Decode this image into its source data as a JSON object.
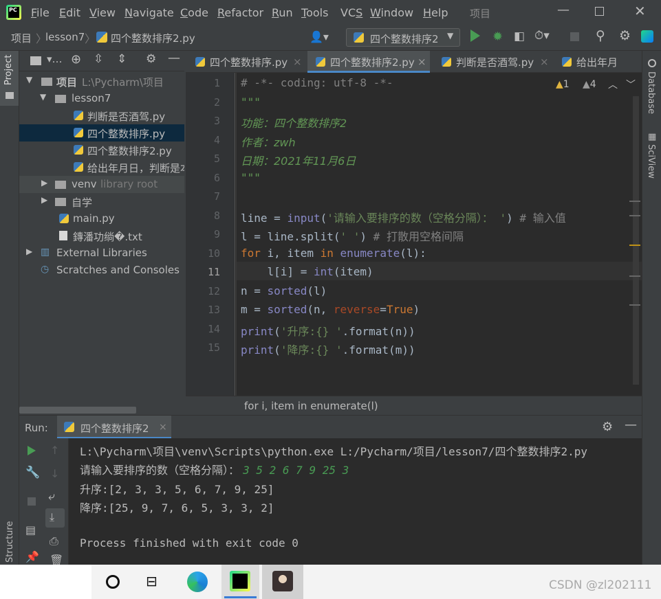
{
  "app": {
    "logo": "PC",
    "project_title": "项目"
  },
  "menu": [
    "File",
    "Edit",
    "View",
    "Navigate",
    "Code",
    "Refactor",
    "Run",
    "Tools",
    "VCS",
    "Window",
    "Help"
  ],
  "menu_mnemonic": [
    "F",
    "E",
    "V",
    "N",
    "C",
    "R",
    "R",
    "T",
    "S",
    "W",
    "H"
  ],
  "breadcrumb": {
    "root": "项目",
    "folder": "lesson7",
    "file": "四个整数排序2.py"
  },
  "run_config": "四个整数排序2",
  "left_tool": {
    "project": "Project",
    "structure": "Structure"
  },
  "right_tool": {
    "database": "Database",
    "sciview": "SciView"
  },
  "project_tree": [
    {
      "label": "项目",
      "extra": "L:\\Pycharm\\项目",
      "level": 0,
      "arrow": "open",
      "kind": "folder"
    },
    {
      "label": "lesson7",
      "extra": "",
      "level": 1,
      "arrow": "open",
      "kind": "folder"
    },
    {
      "label": "判断是否酒驾.py",
      "extra": "",
      "level": 2,
      "arrow": "",
      "kind": "py"
    },
    {
      "label": "四个整数排序.py",
      "extra": "",
      "level": 2,
      "arrow": "",
      "kind": "py",
      "selected": true
    },
    {
      "label": "四个整数排序2.py",
      "extra": "",
      "level": 2,
      "arrow": "",
      "kind": "py"
    },
    {
      "label": "给出年月日，判断是本",
      "extra": "",
      "level": 2,
      "arrow": "",
      "kind": "py"
    },
    {
      "label": "venv",
      "extra": "library root",
      "level": 1,
      "arrow": "closed",
      "kind": "folder",
      "highlight": true
    },
    {
      "label": "自学",
      "extra": "",
      "level": 1,
      "arrow": "closed",
      "kind": "folder"
    },
    {
      "label": "main.py",
      "extra": "",
      "level": 1,
      "arrow": "",
      "kind": "py"
    },
    {
      "label": "鏄潘功绱�.txt",
      "extra": "",
      "level": 1,
      "arrow": "",
      "kind": "txt"
    },
    {
      "label": "External Libraries",
      "extra": "",
      "level": 0,
      "arrow": "closed",
      "kind": "lib"
    },
    {
      "label": "Scratches and Consoles",
      "extra": "",
      "level": 0,
      "arrow": "",
      "kind": "scratch"
    }
  ],
  "tabs": [
    {
      "label": "四个整数排序.py",
      "active": false
    },
    {
      "label": "四个整数排序2.py",
      "active": true
    },
    {
      "label": "判断是否酒驾.py",
      "active": false
    },
    {
      "label": "给出年月",
      "active": false
    }
  ],
  "inspections": {
    "warnings": "1",
    "weak": "4"
  },
  "code_lines": [
    "1",
    "2",
    "3",
    "4",
    "5",
    "6",
    "7",
    "8",
    "9",
    "10",
    "11",
    "12",
    "13",
    "14",
    "15"
  ],
  "code": {
    "l1": "# -*- coding: utf-8 -*-",
    "l2": "\"\"\"",
    "l3": "功能：四个整数排序2",
    "l4": "作者：zwh",
    "l5": "日期：2021年11月6日",
    "l6": "\"\"\"",
    "l8a": "line = ",
    "l8b": "input",
    "l8c": "(",
    "l8d": "'请输入要排序的数（空格分隔）： '",
    "l8e": ") ",
    "l8f": "# 输入值",
    "l9a": "l = line.split(",
    "l9b": "' '",
    "l9c": ") ",
    "l9d": "# 打散用空格间隔",
    "l10a": "for",
    "l10b": " i, item ",
    "l10c": "in",
    "l10d": " ",
    "l10e": "enumerate",
    "l10f": "(l):",
    "l11a": "    l[i] = ",
    "l11b": "int",
    "l11c": "(item)",
    "l12a": "n = ",
    "l12b": "sorted",
    "l12c": "(l)",
    "l13a": "m = ",
    "l13b": "sorted",
    "l13c": "(n, ",
    "l13d": "reverse",
    "l13e": "=",
    "l13f": "True",
    "l13g": ")",
    "l14a": "print",
    "l14b": "(",
    "l14c": "'升序:{} '",
    "l14d": ".format(n))",
    "l15a": "print",
    "l15b": "(",
    "l15c": "'降序:{} '",
    "l15d": ".format(m))"
  },
  "editor_breadcrumb": "for i, item in enumerate(l)",
  "run": {
    "label": "Run:",
    "tab": "四个整数排序2",
    "output": [
      "L:\\Pycharm\\项目\\venv\\Scripts\\python.exe L:/Pycharm/项目/lesson7/四个整数排序2.py",
      "请输入要排序的数（空格分隔）：",
      "升序:[2, 3, 3, 5, 6, 7, 9, 25]",
      "降序:[25, 9, 7, 6, 5, 3, 3, 2]",
      "",
      "Process finished with exit code 0"
    ],
    "user_input": "3 5 2 6 7 9 25 3"
  },
  "taskbar": {
    "watermark": "CSDN @zl202111"
  },
  "colors": {
    "accent": "#4a88c7",
    "run_green": "#499c54",
    "selection": "#0d293e"
  }
}
